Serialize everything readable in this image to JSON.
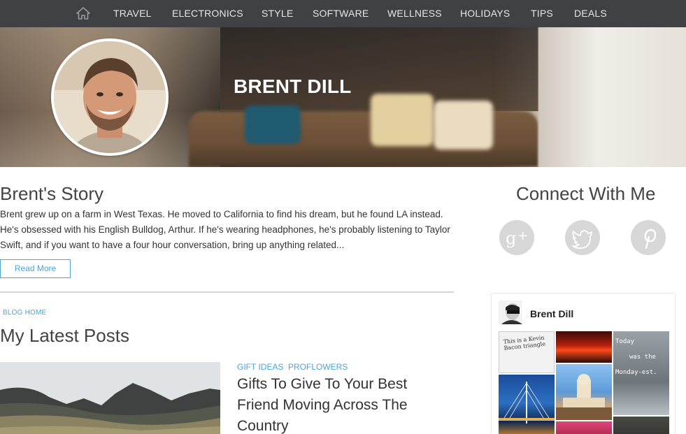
{
  "nav": {
    "home_icon": "home-icon",
    "items": [
      "TRAVEL",
      "ELECTRONICS",
      "STYLE",
      "SOFTWARE",
      "WELLNESS",
      "HOLIDAYS",
      "TIPS",
      "DEALS"
    ]
  },
  "hero": {
    "name": "BRENT DILL"
  },
  "story": {
    "title": "Brent's Story",
    "text": "Brent grew up on a farm in West Texas. He moved to California to find his dream, but he found LA instead. He's obsessed with his English Bulldog, Arthur. If he's wearing headphones, he's probably listening to Taylor Swift, and if you want to have a four hour conversation, bring up anything related...",
    "read_more": "Read More"
  },
  "blog": {
    "breadcrumb": "BLOG HOME",
    "title": "My Latest Posts",
    "post": {
      "tags": [
        "GIFT IDEAS",
        "PROFLOWERS"
      ],
      "title": "Gifts To Give To Your Best Friend Moving Across The Country"
    }
  },
  "connect": {
    "title": "Connect With Me",
    "networks": [
      "google-plus-icon",
      "twitter-icon",
      "pinterest-icon"
    ]
  },
  "widget": {
    "name": "Brent Dill",
    "pins": {
      "note_text": "This is a Kevin Bacon triangle",
      "today_text": [
        "Today",
        "was the",
        "Monday-est."
      ]
    }
  },
  "colors": {
    "nav_bg": "#3f4144",
    "accent": "#4fa3d8",
    "social_bg": "#d7d7d7",
    "divider": "#d6d6d6"
  }
}
